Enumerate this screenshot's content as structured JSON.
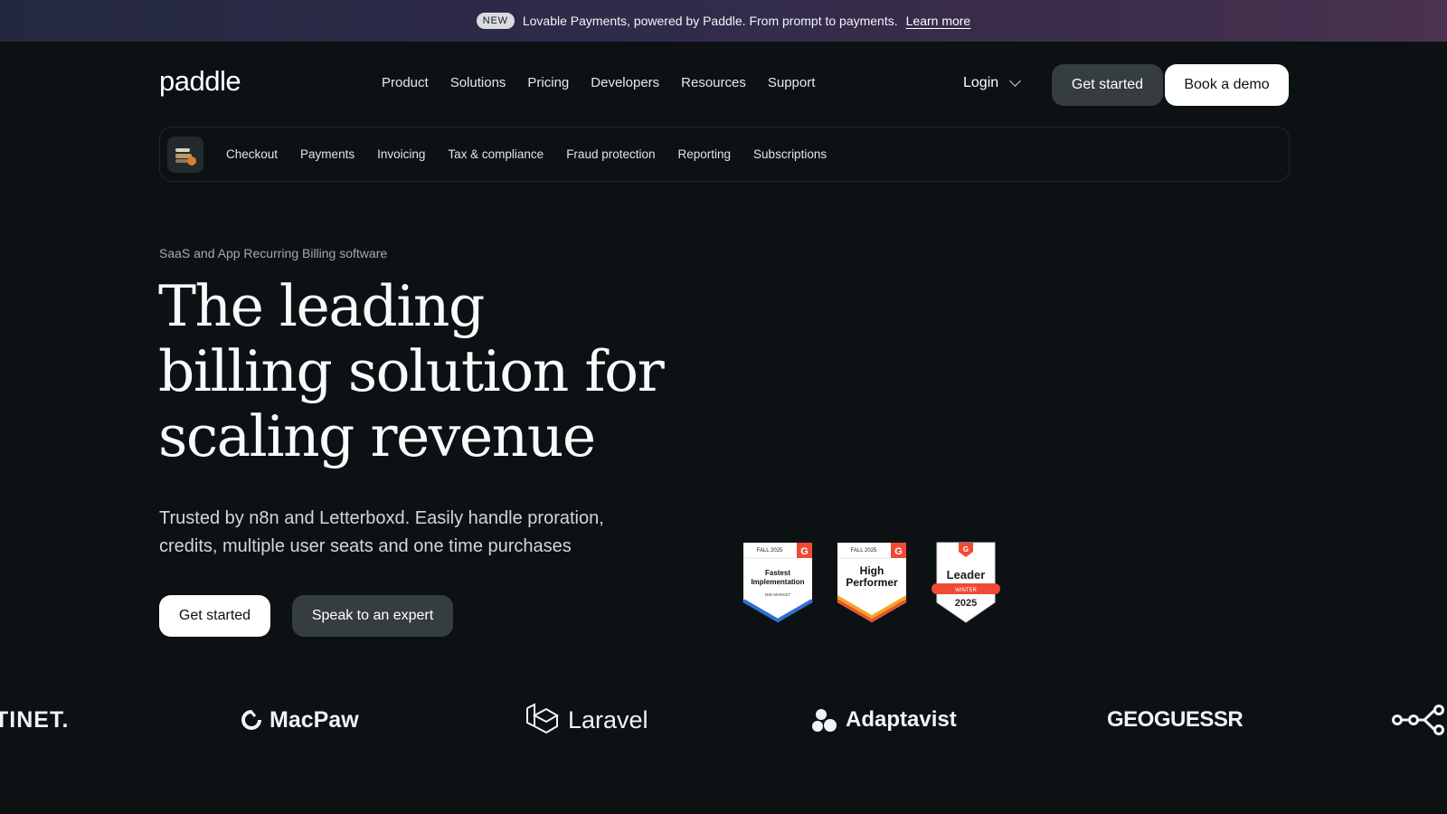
{
  "promo": {
    "badge": "NEW",
    "text": "Lovable Payments, powered by Paddle. From prompt to payments.",
    "link": "Learn more"
  },
  "header": {
    "logo": "paddle",
    "nav": [
      "Product",
      "Solutions",
      "Pricing",
      "Developers",
      "Resources",
      "Support"
    ],
    "login": "Login",
    "get_started": "Get started",
    "book_demo": "Book a demo"
  },
  "subnav": {
    "items": [
      "Checkout",
      "Payments",
      "Invoicing",
      "Tax & compliance",
      "Fraud protection",
      "Reporting",
      "Subscriptions"
    ]
  },
  "hero": {
    "eyebrow": "SaaS and App Recurring Billing software",
    "headline": "The leading billing solution for scaling revenue",
    "subtext": "Trusted by n8n and Letterboxd. Easily handle proration, credits, multiple user seats and one time purchases",
    "primary_cta": "Get started",
    "secondary_cta": "Speak to an expert"
  },
  "badges": [
    {
      "season": "FALL 2025",
      "title": "Fastest Implementation",
      "segment": "MID-MARKET"
    },
    {
      "season": "FALL 2025",
      "title": "High Performer"
    },
    {
      "title": "Leader",
      "season": "WINTER",
      "year": "2025"
    }
  ],
  "customer_logos": [
    "TINET.",
    "MacPaw",
    "Laravel",
    "Adaptavist",
    "GEOGUESSR",
    "n8n"
  ],
  "colors": {
    "background": "#0c1214",
    "button_dark": "#363d41",
    "g2_red": "#ef4a35"
  }
}
